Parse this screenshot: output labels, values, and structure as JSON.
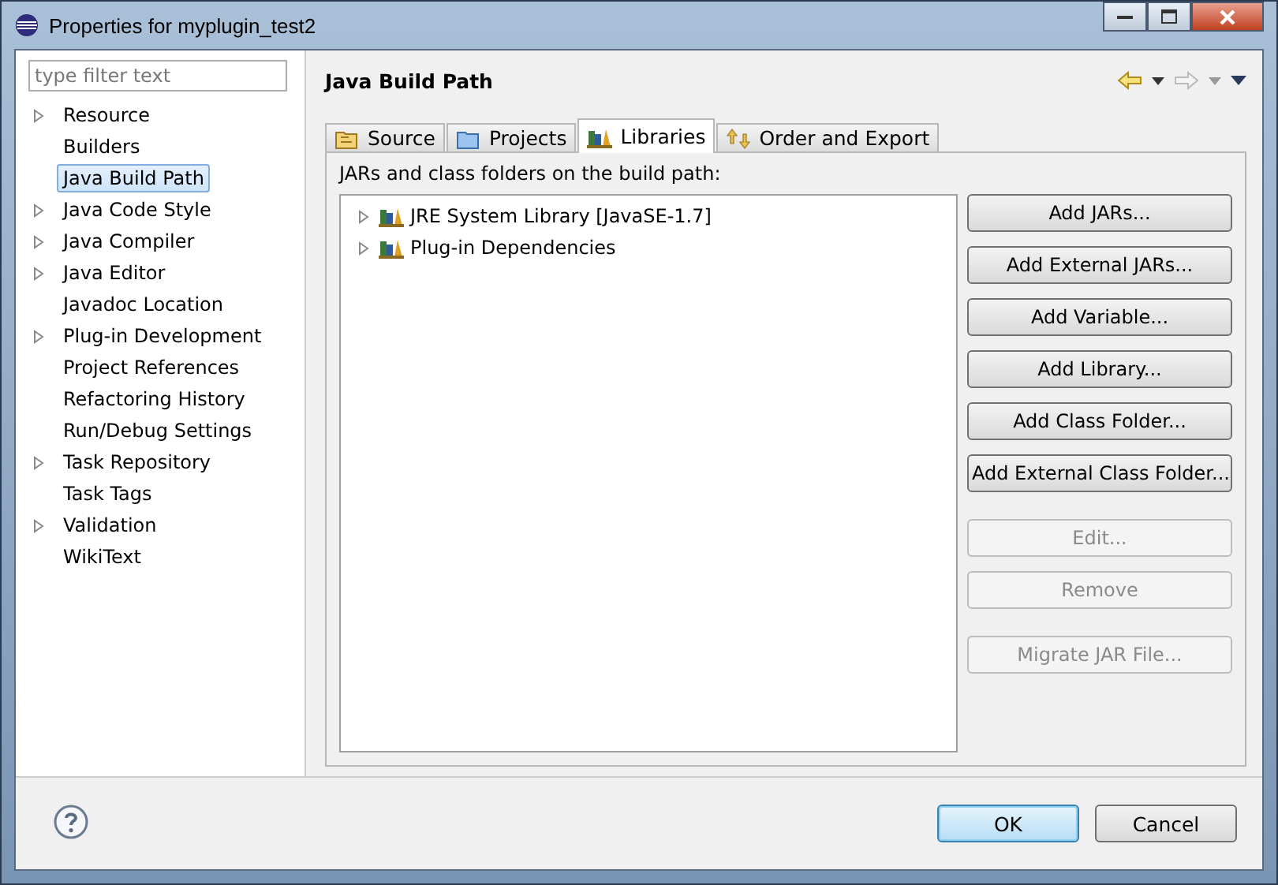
{
  "window": {
    "title": "Properties for myplugin_test2"
  },
  "sidebar": {
    "filter": {
      "placeholder": "type filter text"
    },
    "items": [
      {
        "label": "Resource",
        "expandable": true,
        "selected": false
      },
      {
        "label": "Builders",
        "expandable": false,
        "selected": false
      },
      {
        "label": "Java Build Path",
        "expandable": false,
        "selected": true
      },
      {
        "label": "Java Code Style",
        "expandable": true,
        "selected": false
      },
      {
        "label": "Java Compiler",
        "expandable": true,
        "selected": false
      },
      {
        "label": "Java Editor",
        "expandable": true,
        "selected": false
      },
      {
        "label": "Javadoc Location",
        "expandable": false,
        "selected": false
      },
      {
        "label": "Plug-in Development",
        "expandable": true,
        "selected": false
      },
      {
        "label": "Project References",
        "expandable": false,
        "selected": false
      },
      {
        "label": "Refactoring History",
        "expandable": false,
        "selected": false
      },
      {
        "label": "Run/Debug Settings",
        "expandable": false,
        "selected": false
      },
      {
        "label": "Task Repository",
        "expandable": true,
        "selected": false
      },
      {
        "label": "Task Tags",
        "expandable": false,
        "selected": false
      },
      {
        "label": "Validation",
        "expandable": true,
        "selected": false
      },
      {
        "label": "WikiText",
        "expandable": false,
        "selected": false
      }
    ]
  },
  "page": {
    "title": "Java Build Path",
    "tabs": [
      {
        "label": "Source",
        "kind": "source",
        "selected": false
      },
      {
        "label": "Projects",
        "kind": "projects",
        "selected": false
      },
      {
        "label": "Libraries",
        "kind": "libraries",
        "selected": true
      },
      {
        "label": "Order and Export",
        "kind": "order",
        "selected": false
      }
    ],
    "libraries_label": "JARs and class folders on the build path:",
    "tree": [
      {
        "label": "JRE System Library [JavaSE-1.7]",
        "expandable": true
      },
      {
        "label": "Plug-in Dependencies",
        "expandable": true
      }
    ],
    "button_groups": [
      {
        "buttons": [
          {
            "label": "Add JARs...",
            "disabled": false
          },
          {
            "label": "Add External JARs...",
            "disabled": false
          },
          {
            "label": "Add Variable...",
            "disabled": false
          },
          {
            "label": "Add Library...",
            "disabled": false
          },
          {
            "label": "Add Class Folder...",
            "disabled": false
          },
          {
            "label": "Add External Class Folder...",
            "disabled": false
          }
        ]
      },
      {
        "buttons": [
          {
            "label": "Edit...",
            "disabled": true
          },
          {
            "label": "Remove",
            "disabled": true
          }
        ]
      },
      {
        "buttons": [
          {
            "label": "Migrate JAR File...",
            "disabled": true
          }
        ]
      }
    ]
  },
  "footer": {
    "buttons": [
      {
        "label": "OK",
        "kind": "default"
      },
      {
        "label": "Cancel",
        "kind": "normal"
      }
    ]
  }
}
